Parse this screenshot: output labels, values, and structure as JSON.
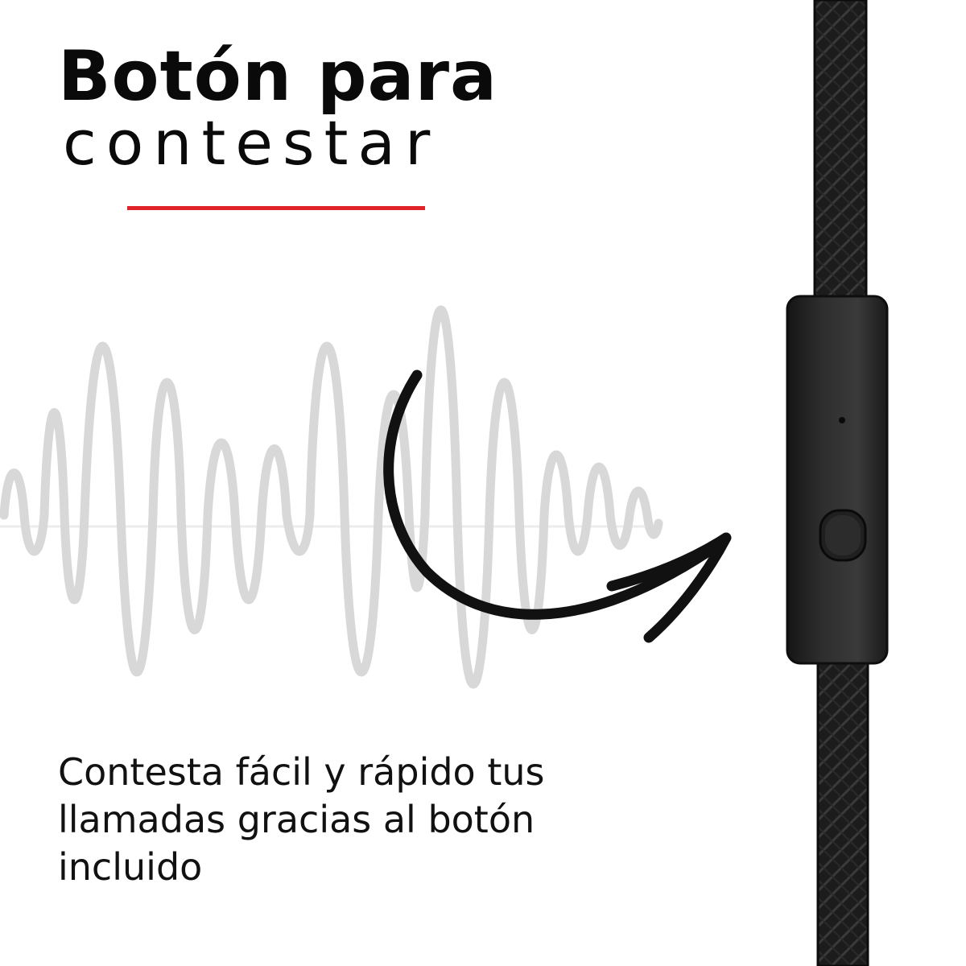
{
  "headline": {
    "bold": "Botón para",
    "light": "contestar"
  },
  "description": "Contesta fácil y rápido tus llamadas gracias al botón incluido",
  "colors": {
    "accent": "#e0232b",
    "text": "#0a0a0a",
    "waveform": "#d8d8d8",
    "cable": "#1c1c1c"
  },
  "icons": [
    "sound-wave-icon",
    "curved-arrow-icon",
    "headphone-cable-image",
    "remote-button-icon"
  ]
}
